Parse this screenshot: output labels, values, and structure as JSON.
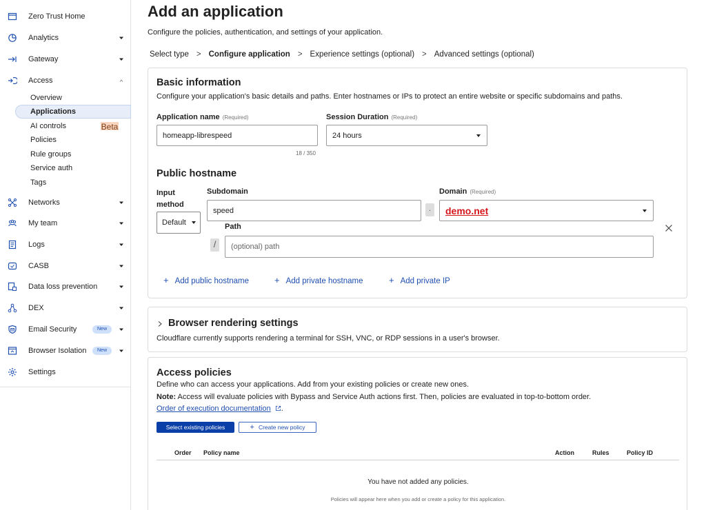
{
  "sidebar": {
    "items": [
      {
        "label": "Zero Trust Home",
        "icon": "browser-window-icon"
      },
      {
        "label": "Analytics",
        "icon": "chart-clock-icon"
      },
      {
        "label": "Gateway",
        "icon": "gateway-arrow-icon"
      },
      {
        "label": "Access",
        "icon": "access-key-icon"
      },
      {
        "label": "Networks",
        "icon": "network-icon"
      },
      {
        "label": "My team",
        "icon": "team-icon"
      },
      {
        "label": "Logs",
        "icon": "logs-icon"
      },
      {
        "label": "CASB",
        "icon": "casb-shield-icon"
      },
      {
        "label": "Data loss prevention",
        "icon": "dlp-document-icon"
      },
      {
        "label": "DEX",
        "icon": "dex-nodes-icon"
      },
      {
        "label": "Email Security",
        "icon": "email-security-icon"
      },
      {
        "label": "Browser Isolation",
        "icon": "browser-isolation-icon"
      },
      {
        "label": "Settings",
        "icon": "gear-icon"
      }
    ],
    "access_sub": [
      "Overview",
      "Applications",
      "AI controls",
      "Policies",
      "Rule groups",
      "Service auth",
      "Tags"
    ],
    "badges": {
      "beta": "Beta",
      "new": "New"
    }
  },
  "page": {
    "title": "Add an application",
    "subtitle": "Configure the policies, authentication, and settings of your application.",
    "steps": [
      "Select type",
      "Configure application",
      "Experience settings (optional)",
      "Advanced settings (optional)"
    ],
    "step_sep": ">"
  },
  "basic": {
    "heading": "Basic information",
    "desc": "Configure your application's basic details and paths. Enter hostnames or IPs to protect an entire website or specific subdomains and paths.",
    "app_name_label": "Application name",
    "required": "(Required)",
    "app_name_value": "homeapp-librespeed",
    "app_name_counter": "18 / 350",
    "session_label": "Session Duration",
    "session_value": "24 hours",
    "public_hostname_heading": "Public hostname",
    "input_method_label": "Input method",
    "input_method_value": "Default",
    "subdomain_label": "Subdomain",
    "subdomain_value": "speed",
    "dot": ".",
    "domain_label": "Domain",
    "domain_value": "demo.net",
    "path_label": "Path",
    "slash": "/",
    "path_placeholder": "(optional) path",
    "add_public": "Add public hostname",
    "add_private": "Add private hostname",
    "add_ip": "Add private IP"
  },
  "browser": {
    "heading": "Browser rendering settings",
    "desc": "Cloudflare currently supports rendering a terminal for SSH, VNC, or RDP sessions in a user's browser."
  },
  "policies": {
    "heading": "Access policies",
    "desc": "Define who can access your applications. Add from your existing policies or create new ones.",
    "note_label": "Note:",
    "note_text": " Access will evaluate policies with Bypass and Service Auth actions first. Then, policies are evaluated in top-to-bottom order.",
    "doc_link": "Order of execution documentation",
    "doc_suffix": ".",
    "select_btn": "Select existing policies",
    "create_btn": "Create new policy",
    "columns": [
      "Order",
      "Policy name",
      "Action",
      "Rules",
      "Policy ID"
    ],
    "empty_title": "You have not added any policies.",
    "empty_sub": "Policies will appear here when you add or create a policy for this application."
  },
  "colors": {
    "accent": "#0b3fa8",
    "link": "#1f4fb0",
    "domain_red": "#d4161c"
  }
}
